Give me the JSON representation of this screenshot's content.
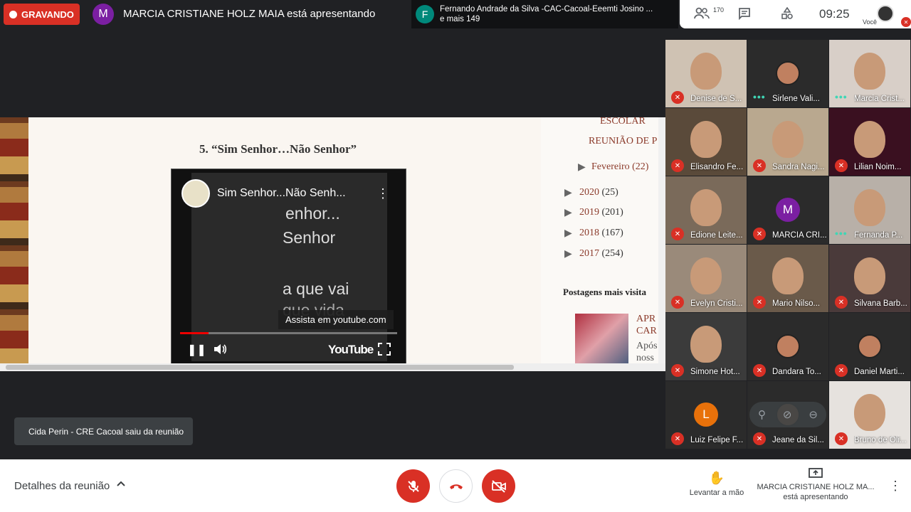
{
  "recording": {
    "label": "GRAVANDO"
  },
  "presenter_bar": {
    "avatar_letter": "M",
    "text": "MARCIA CRISTIANE HOLZ MAIA está apresentando"
  },
  "active_speaker": {
    "avatar_letter": "F",
    "line1": "Fernando Andrade da Silva -CAC-Cacoal-Eeemti Josino ...",
    "line2": "e mais 149"
  },
  "top_right": {
    "participants_count": "170",
    "time": "09:25",
    "you_label": "Você",
    "icons": [
      "people-icon",
      "chat-icon",
      "activities-icon"
    ]
  },
  "shared_screen": {
    "heading": "5. “Sim Senhor…Não Senhor”",
    "video": {
      "title": "Sim Senhor...Não Senh...",
      "lines": [
        "enhor...",
        "Senhor",
        "a que vai",
        "que vida"
      ],
      "watch_hint": "Assista em youtube.com",
      "brand": "YouTube",
      "progress": 0.13,
      "buffered": 0.64
    },
    "sidebar": {
      "escolar": "ESCOLAR",
      "reuniao": "REUNIÃO DE P",
      "fevereiro": "Fevereiro (22)",
      "years": [
        {
          "year": "2020",
          "count": "(25)"
        },
        {
          "year": "2019",
          "count": "(201)"
        },
        {
          "year": "2018",
          "count": "(167)"
        },
        {
          "year": "2017",
          "count": "(254)"
        }
      ],
      "popular_title": "Postagens mais visita",
      "article_title": [
        "APR",
        "CAR"
      ],
      "article_text": [
        "Após",
        "noss"
      ]
    }
  },
  "toast": {
    "text": "Cida Perin - CRE Cacoal saiu da reunião"
  },
  "participants": [
    {
      "name": "Denise de S..."
    },
    {
      "name": "Sirlene Vali..."
    },
    {
      "name": "Marcia Crist..."
    },
    {
      "name": "Elisandro Fe..."
    },
    {
      "name": "Sandra Nagi..."
    },
    {
      "name": "Lilian Noim..."
    },
    {
      "name": "Edione Leite..."
    },
    {
      "name": "MARCIA CRI...",
      "letter": "M"
    },
    {
      "name": "Fernanda P..."
    },
    {
      "name": "Evelyn Cristi..."
    },
    {
      "name": "Mario Nilso..."
    },
    {
      "name": "Silvana Barb..."
    },
    {
      "name": "Simone Hot..."
    },
    {
      "name": "Dandara To..."
    },
    {
      "name": "Daniel Marti..."
    },
    {
      "name": "Luiz Felipe F...",
      "letter": "L"
    },
    {
      "name": "Jeane da Sil..."
    },
    {
      "name": "Bruno de Oli..."
    }
  ],
  "bottom": {
    "details_label": "Detalhes da reunião",
    "raise_hand_label": "Levantar a mão",
    "presenting_line1": "MARCIA CRISTIANE HOLZ MA...",
    "presenting_line2": "está apresentando"
  },
  "colors": {
    "red": "#d93025",
    "purple": "#7b1fa2",
    "teal": "#00897b",
    "orange": "#e8710a"
  }
}
